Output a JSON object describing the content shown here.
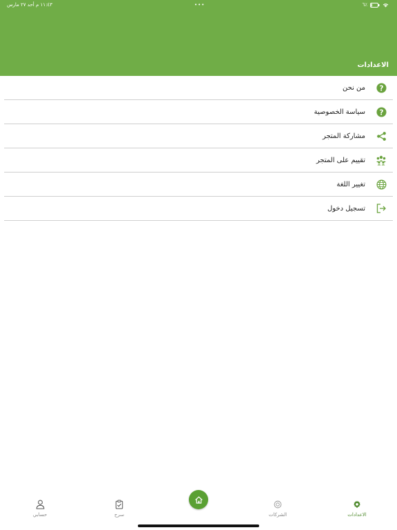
{
  "status_bar": {
    "time_date": "١١:٤٣ م  أحد ٢٧ مارس",
    "dots": "•••",
    "battery": "٦٪"
  },
  "header": {
    "title": "الاعدادات"
  },
  "settings": {
    "items": [
      {
        "label": "من نحن",
        "icon": "question-icon"
      },
      {
        "label": "سياسة الخصوصية",
        "icon": "question-icon"
      },
      {
        "label": "مشاركة المتجر",
        "icon": "share-icon"
      },
      {
        "label": "تقييم على المتجر",
        "icon": "group-icon"
      },
      {
        "label": "تغيير اللغة",
        "icon": "globe-icon"
      },
      {
        "label": "تسجيل دخول",
        "icon": "login-icon"
      }
    ]
  },
  "tabbar": {
    "settings_label": "الاعدادات",
    "companies_label": "الشركات",
    "cart_label": "سرج",
    "account_label": "حسابي"
  },
  "colors": {
    "brand_green": "#70ad47",
    "active_green": "#4f8a2d"
  }
}
